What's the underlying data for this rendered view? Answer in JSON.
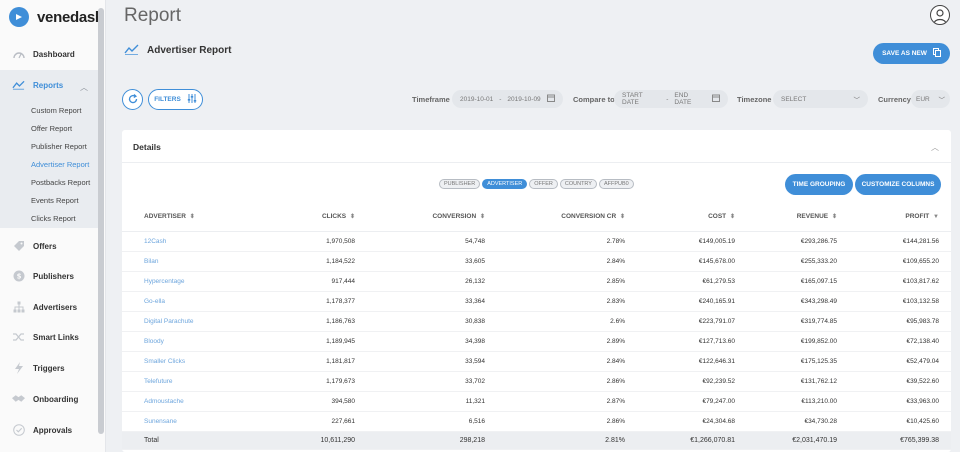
{
  "brand": {
    "name": "venedash"
  },
  "sidebar": {
    "items": [
      {
        "label": "Dashboard",
        "icon": "gauge-icon"
      },
      {
        "label": "Reports",
        "icon": "chart-line-icon"
      },
      {
        "label": "Offers",
        "icon": "tag-icon"
      },
      {
        "label": "Publishers",
        "icon": "dollar-icon"
      },
      {
        "label": "Advertisers",
        "icon": "org-chart-icon"
      },
      {
        "label": "Smart Links",
        "icon": "shuffle-icon"
      },
      {
        "label": "Triggers",
        "icon": "bolt-icon"
      },
      {
        "label": "Onboarding",
        "icon": "handshake-icon"
      },
      {
        "label": "Approvals",
        "icon": "check-circle-icon"
      }
    ],
    "reports_sub": [
      "Custom Report",
      "Offer Report",
      "Publisher Report",
      "Advertiser Report",
      "Postbacks Report",
      "Events Report",
      "Clicks Report"
    ]
  },
  "header": {
    "title": "Report",
    "subtitle": "Advertiser Report",
    "save_label": "SAVE AS NEW"
  },
  "filters": {
    "filters_label": "FILTERS",
    "timeframe_label": "Timeframe",
    "timeframe_start": "2019-10-01",
    "timeframe_sep": "-",
    "timeframe_end": "2019-10-09",
    "compare_label": "Compare to",
    "compare_start": "START DATE",
    "compare_sep": "-",
    "compare_end": "END DATE",
    "timezone_label": "Timezone",
    "timezone_value": "SELECT",
    "currency_label": "Currency",
    "currency_value": "EUR"
  },
  "details": {
    "title": "Details",
    "tabs": [
      "PUBLISHER",
      "ADVERTISER",
      "OFFER",
      "COUNTRY",
      "AFFPUB0"
    ],
    "time_grouping_label": "TIME GROUPING",
    "customize_label": "CUSTOMIZE COLUMNS",
    "columns": [
      "ADVERTISER",
      "CLICKS",
      "CONVERSION",
      "CONVERSION CR",
      "COST",
      "REVENUE",
      "PROFIT"
    ],
    "rows": [
      [
        "12Cash",
        "1,970,508",
        "54,748",
        "2.78%",
        "€149,005.19",
        "€293,286.75",
        "€144,281.56"
      ],
      [
        "Bilan",
        "1,184,522",
        "33,605",
        "2.84%",
        "€145,678.00",
        "€255,333.20",
        "€109,655.20"
      ],
      [
        "Hypercentage",
        "917,444",
        "26,132",
        "2.85%",
        "€61,279.53",
        "€165,097.15",
        "€103,817.62"
      ],
      [
        "Go-ella",
        "1,178,377",
        "33,364",
        "2.83%",
        "€240,165.91",
        "€343,298.49",
        "€103,132.58"
      ],
      [
        "Digital Parachute",
        "1,186,763",
        "30,838",
        "2.6%",
        "€223,791.07",
        "€319,774.85",
        "€95,983.78"
      ],
      [
        "Bloody",
        "1,189,945",
        "34,398",
        "2.89%",
        "€127,713.60",
        "€199,852.00",
        "€72,138.40"
      ],
      [
        "Smaller Clicks",
        "1,181,817",
        "33,594",
        "2.84%",
        "€122,646.31",
        "€175,125.35",
        "€52,479.04"
      ],
      [
        "Telefuture",
        "1,179,673",
        "33,702",
        "2.86%",
        "€92,239.52",
        "€131,762.12",
        "€39,522.60"
      ],
      [
        "Admoustache",
        "394,580",
        "11,321",
        "2.87%",
        "€79,247.00",
        "€113,210.00",
        "€33,963.00"
      ],
      [
        "Sunensane",
        "227,661",
        "6,516",
        "2.86%",
        "€24,304.68",
        "€34,730.28",
        "€10,425.60"
      ]
    ],
    "total": [
      "Total",
      "10,611,290",
      "298,218",
      "2.81%",
      "€1,266,070.81",
      "€2,031,470.19",
      "€765,399.38"
    ]
  }
}
